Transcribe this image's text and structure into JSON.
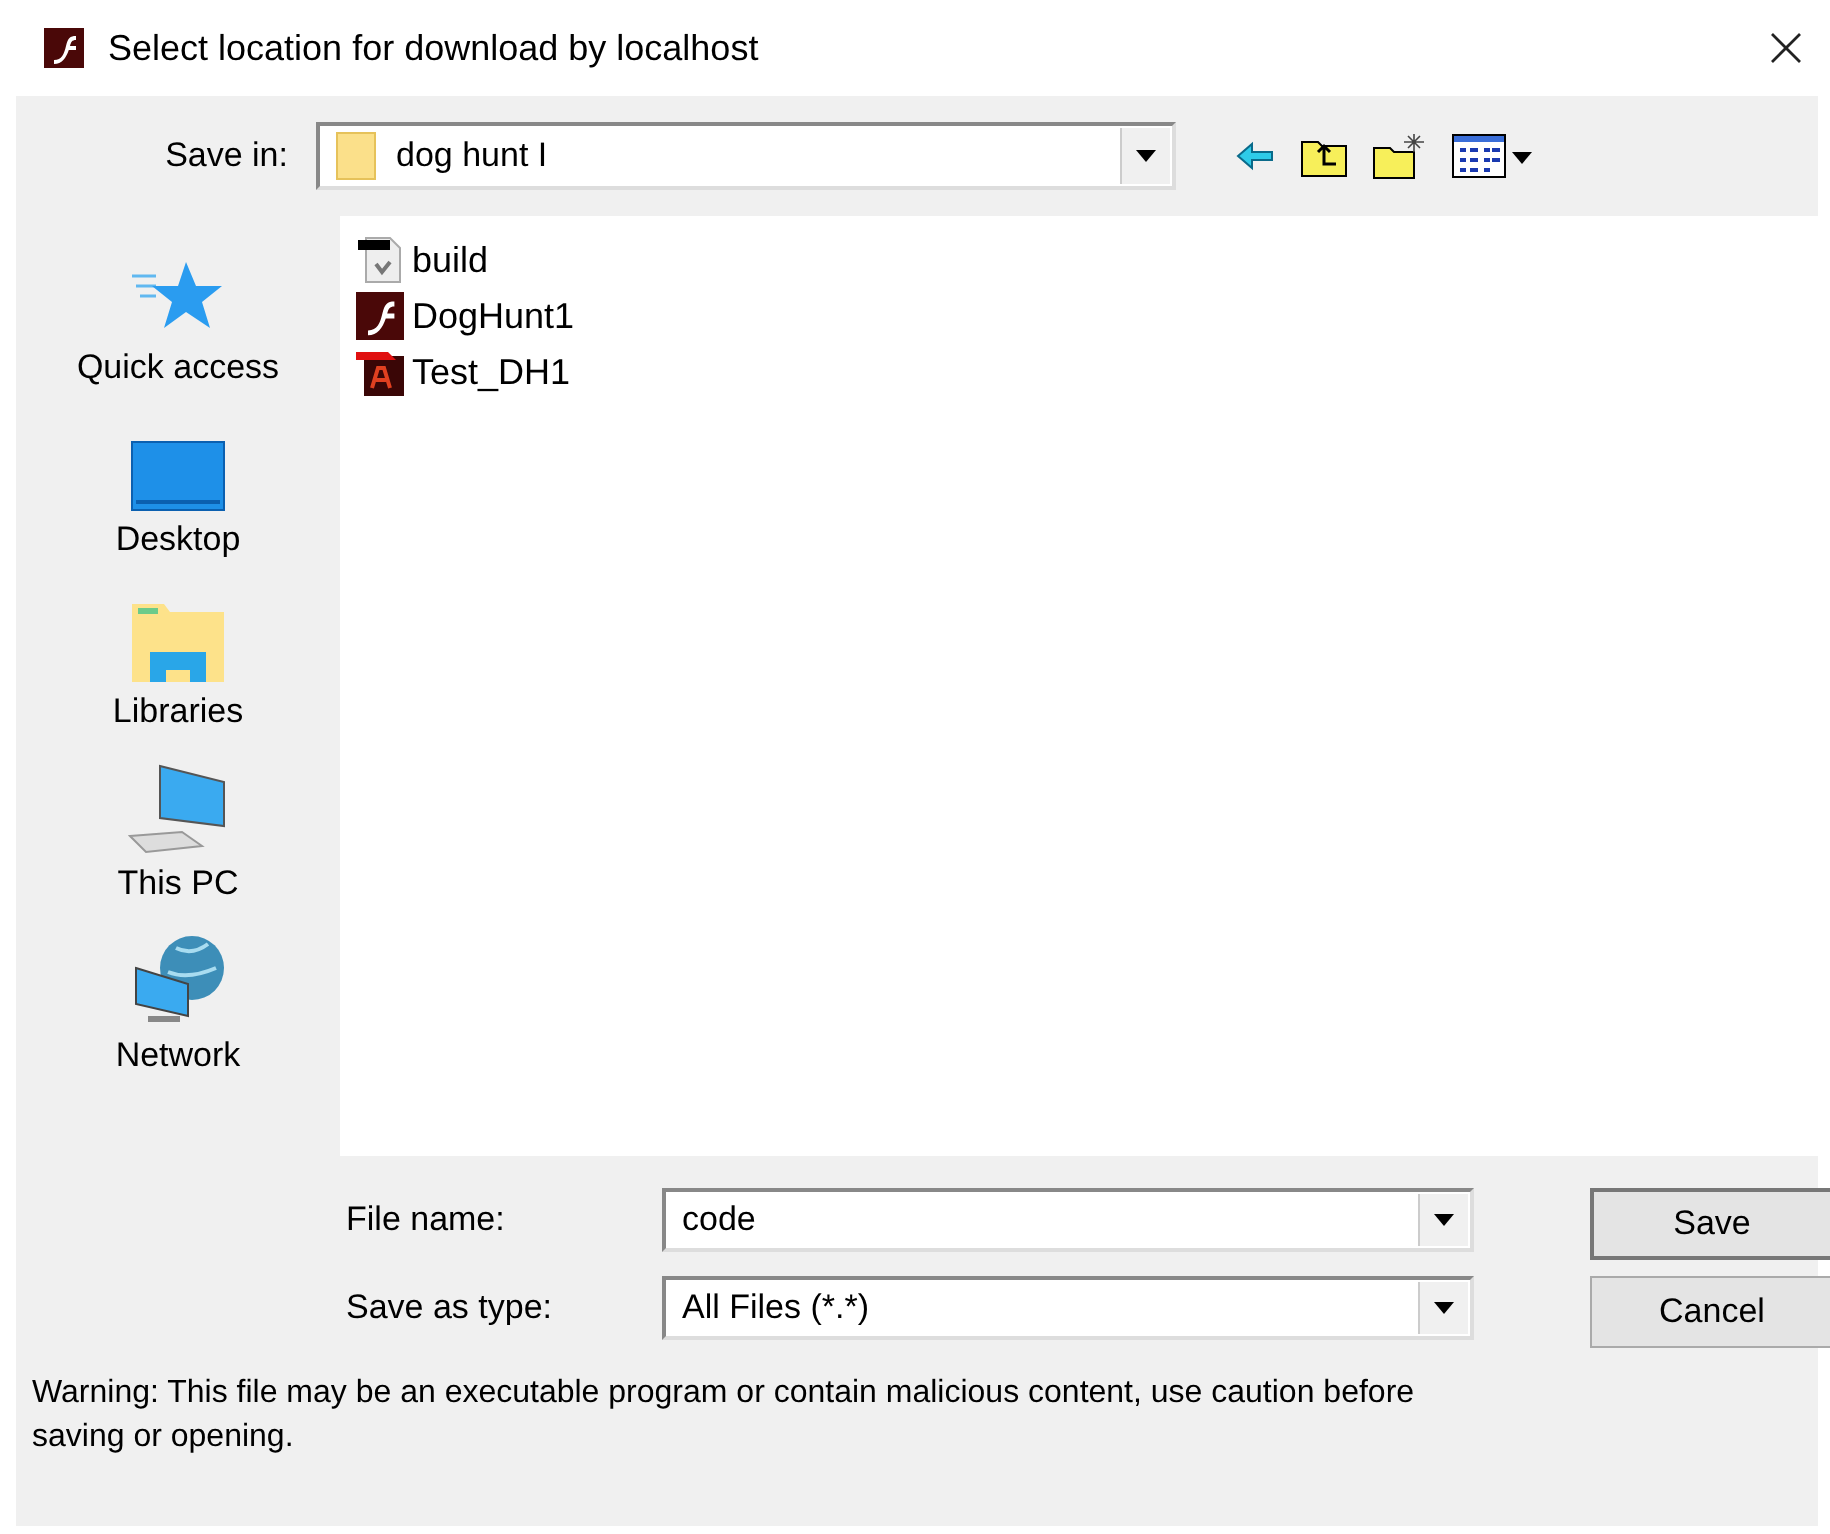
{
  "window": {
    "title": "Select location for download by localhost"
  },
  "save_in": {
    "label": "Save in:",
    "value": "dog hunt I"
  },
  "places": [
    {
      "kind": "quick",
      "label": "Quick access"
    },
    {
      "kind": "desktop",
      "label": "Desktop"
    },
    {
      "kind": "libraries",
      "label": "Libraries"
    },
    {
      "kind": "pc",
      "label": "This PC"
    },
    {
      "kind": "network",
      "label": "Network"
    }
  ],
  "files": [
    {
      "kind": "script",
      "name": "build"
    },
    {
      "kind": "flash",
      "name": "DogHunt1"
    },
    {
      "kind": "animate",
      "name": "Test_DH1"
    }
  ],
  "file_name": {
    "label": "File name:",
    "value": "code"
  },
  "save_as_type": {
    "label": "Save as type:",
    "value": "All Files (*.*)"
  },
  "buttons": [
    "Save",
    "Cancel"
  ],
  "warning": "Warning: This file may be an executable program or contain malicious content, use caution before saving or opening."
}
